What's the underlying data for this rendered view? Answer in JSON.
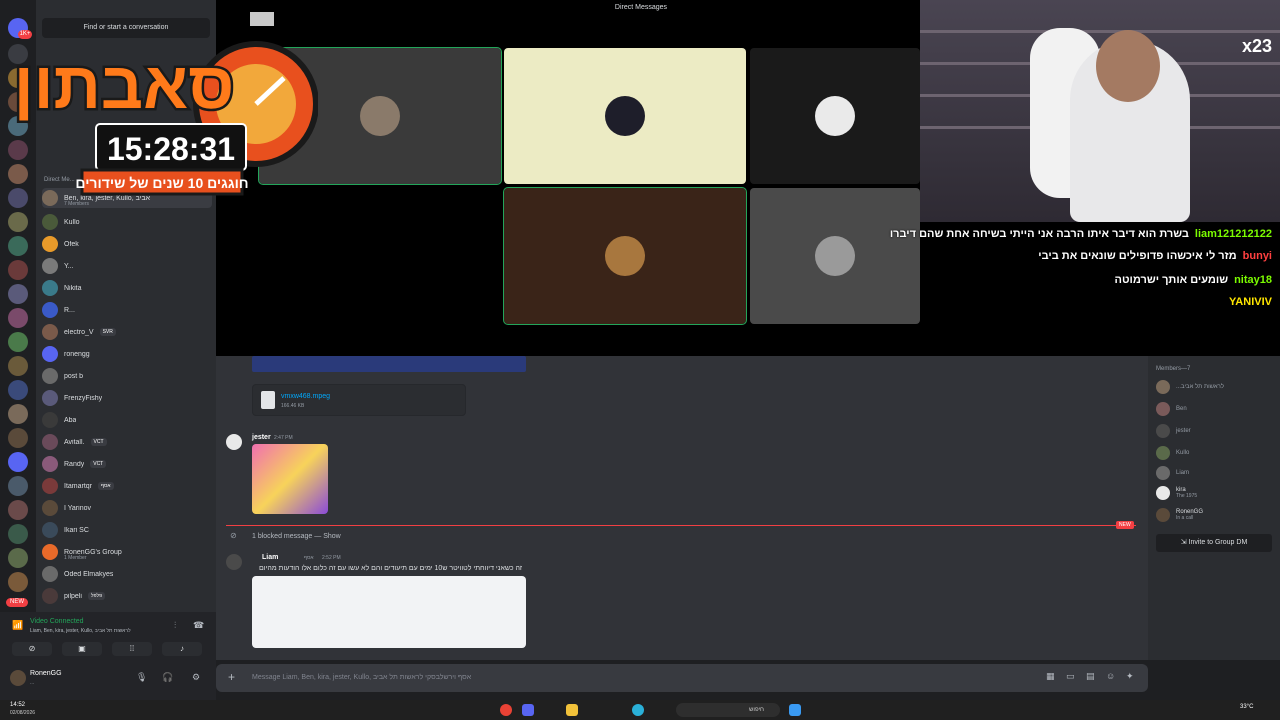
{
  "dm_sidebar": {
    "find_label": "Find or start a conversation",
    "header": "Direct Me...",
    "group_title": "Ben, kira, jester, Kullo, אביב",
    "group_sub": "7 Members",
    "items": [
      {
        "name": "Kullo",
        "tag": ""
      },
      {
        "name": "Ofek",
        "tag": ""
      },
      {
        "name": "Y...",
        "tag": ""
      },
      {
        "name": "Nikita",
        "tag": ""
      },
      {
        "name": "R...",
        "tag": ""
      },
      {
        "name": "electro_V",
        "tag": "SVR"
      },
      {
        "name": "ronengg",
        "tag": ""
      },
      {
        "name": "post b",
        "tag": ""
      },
      {
        "name": "FrenzyFishy",
        "tag": ""
      },
      {
        "name": "Aba",
        "tag": ""
      },
      {
        "name": "Avitall.",
        "tag": "VCT"
      },
      {
        "name": "Randy",
        "tag": "VCT"
      },
      {
        "name": "Itamartqr",
        "tag": "אסף"
      },
      {
        "name": "I Yarinov",
        "tag": ""
      },
      {
        "name": "Ikari SC",
        "tag": ""
      },
      {
        "name": "RonenGG's Group",
        "tag": ""
      },
      {
        "name": "Oded Elmakyes",
        "tag": ""
      },
      {
        "name": "pilpeli",
        "tag": "פלפל"
      }
    ],
    "group_sub2": "1 Member"
  },
  "voice": {
    "title": "Video Connected",
    "sub": "Liam, Ben, kira, jester, Kullo, לראשות תל אביב"
  },
  "user": {
    "name": "RonenGG",
    "status": "..."
  },
  "video": {
    "title": "Direct Messages"
  },
  "logo": {
    "title": "סאבתון",
    "timer": "15:28:31",
    "subtitle": "חוגגים 10 שנים של שידורים"
  },
  "cam": {
    "counter": "x23"
  },
  "stream_chat": [
    {
      "user": "liam121212122",
      "text": "בשרת הוא דיבר איתו הרבה אני הייתי בשיחה אחת שהם דיברו",
      "color": "#7cfc00"
    },
    {
      "user": "bunyi",
      "text": "מזר לי איכשהו פדופילים שונאים את ביבי",
      "color": "#ff4040"
    },
    {
      "user": "nitay18",
      "text": "שומעים אותך ישרמוטה",
      "color": "#7cfc00"
    },
    {
      "user": "YANIVIV",
      "text": "",
      "color": "#ffe600"
    }
  ],
  "chat": {
    "file_name": "vmxw468.mpeg",
    "file_size": "166.46 KB",
    "msg1_author": "jester",
    "msg1_time": "2:47 PM",
    "blocked": "1 blocked message — Show",
    "new_badge": "NEW",
    "msg2_author": "Liam",
    "msg2_tag": "אסף",
    "msg2_time": "2:52 PM",
    "msg2_text": "זה כשאני דיווחתי לטוויטר ש10 ימים עם תיעודים והם לא עשו עם זה כלום אלו הודעות מהיום"
  },
  "members": {
    "header": "Members—7",
    "list": [
      {
        "name": "...לראשות תל אביב",
        "sub": ""
      },
      {
        "name": "Ben",
        "sub": ""
      },
      {
        "name": "jester",
        "sub": ""
      },
      {
        "name": "Kullo",
        "sub": ""
      },
      {
        "name": "Liam",
        "sub": ""
      },
      {
        "name": "kira",
        "sub": "The 1975"
      },
      {
        "name": "RonenGG",
        "sub": "In a call"
      }
    ],
    "invite_label": "Invite to Group DM"
  },
  "composer": {
    "placeholder": "Message Liam, Ben, kira, jester, Kullo, אסף וירשלבסקי לראשות תל אביב"
  },
  "taskbar": {
    "time": "14:52",
    "date": "02/08/2026",
    "temp": "33°C",
    "search": "חיפוש"
  }
}
